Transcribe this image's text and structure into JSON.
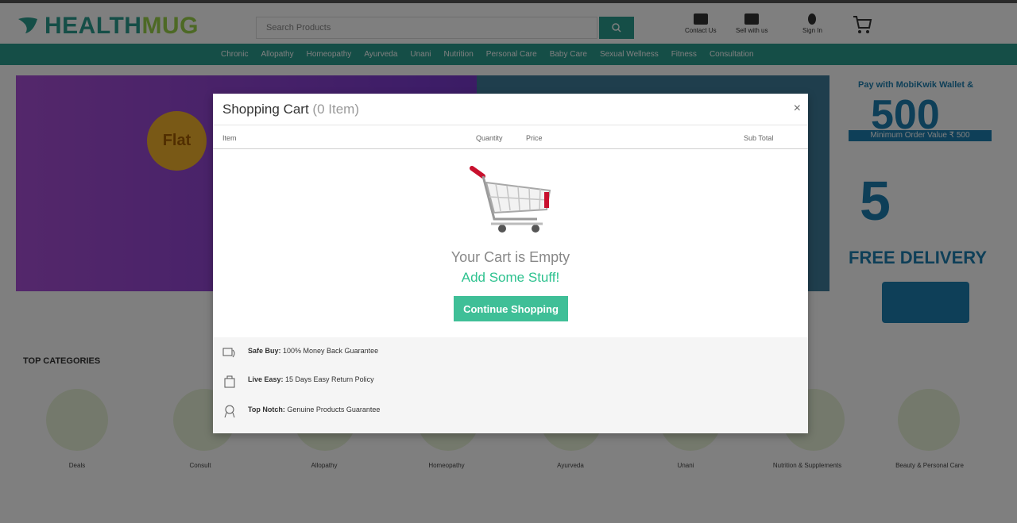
{
  "header": {
    "logo_part1": "HEALTH",
    "logo_part2": "MUG",
    "search_placeholder": "Search Products",
    "contact_label": "Contact Us",
    "sell_label": "Sell with us",
    "signin_label": "Sign In"
  },
  "nav": {
    "items": [
      "Chronic",
      "Allopathy",
      "Homeopathy",
      "Ayurveda",
      "Unani",
      "Nutrition",
      "Personal Care",
      "Baby Care",
      "Sexual Wellness",
      "Fitness",
      "Consultation"
    ]
  },
  "background": {
    "flat_label": "Flat",
    "promo_line1": "Pay with MobiKwik Wallet &",
    "promo_big": "500",
    "promo_bar": "Minimum Order Value ₹ 500",
    "promo_five": "5",
    "free_delivery": "FREE DELIVERY",
    "top_categories": "TOP CATEGORIES",
    "categories": [
      "Deals",
      "Consult",
      "Allopathy",
      "Homeopathy",
      "Ayurveda",
      "Unani",
      "Nutrition & Supplements",
      "Beauty & Personal Care"
    ]
  },
  "cart_modal": {
    "title": "Shopping Cart",
    "count": "(0 Item)",
    "close": "×",
    "col_item": "Item",
    "col_quantity": "Quantity",
    "col_price": "Price",
    "col_subtotal": "Sub Total",
    "empty_line1": "Your Cart is Empty",
    "empty_line2": "Add Some Stuff!",
    "continue_label": "Continue Shopping",
    "guarantees": [
      {
        "bold": "Safe Buy:",
        "text": " 100% Money Back Guarantee"
      },
      {
        "bold": "Live Easy:",
        "text": " 15 Days Easy Return Policy"
      },
      {
        "bold": "Top Notch:",
        "text": " Genuine Products Guarantee"
      }
    ]
  }
}
